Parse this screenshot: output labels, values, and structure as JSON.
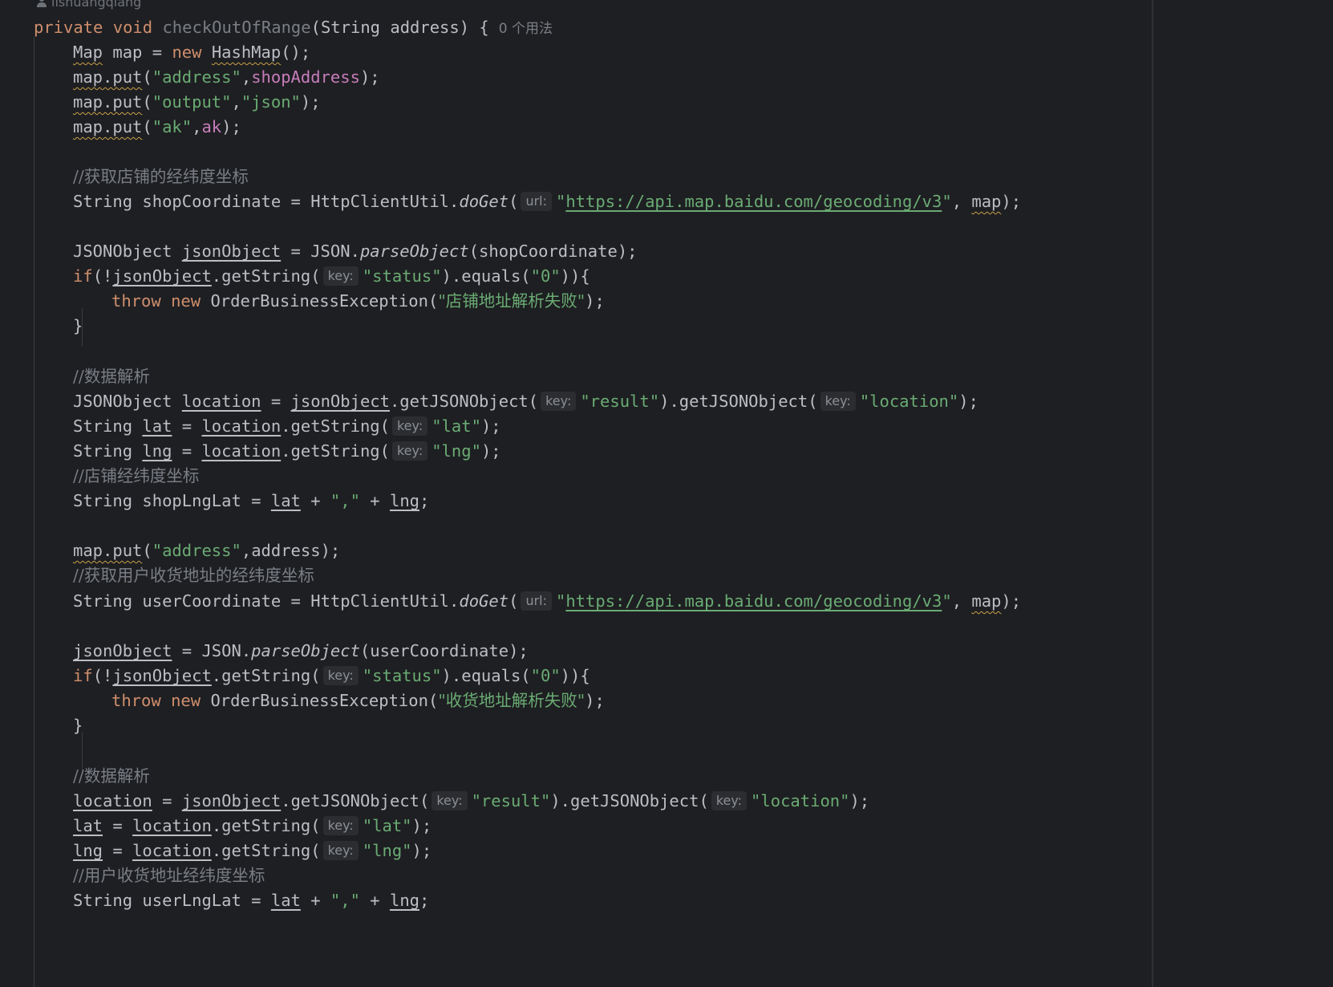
{
  "editor": {
    "author": "lishuangqiang",
    "method": {
      "modifiers": "private",
      "return_type": "void",
      "name": "checkOutOfRange",
      "params": "(String address) {",
      "usages": "0 个用法"
    },
    "code": {
      "map_type": "Map",
      "map_var": "map",
      "eq": " = ",
      "new_kw": "new",
      "hashmap": "HashMap",
      "paren_end": "();",
      "put_call": "map.put",
      "str_address": "\"address\"",
      "shop_address": "shopAddress",
      "str_output": "\"output\"",
      "str_json": "\"json\"",
      "str_ak": "\"ak\"",
      "ak_field": "ak",
      "comment_shop_coord": "//获取店铺的经纬度坐标",
      "string_type": "String",
      "shop_coordinate": "shopCoordinate",
      "http_util": "HttpClientUtil.",
      "do_get": "doGet",
      "hint_url": "url:",
      "url_value": "https://api.map.baidu.com/geocoding/v3",
      "quote": "\"",
      "map_arg": "map",
      "json_object_type": "JSONObject",
      "json_object_var": "jsonObject",
      "json_cls": "JSON.",
      "parse_object": "parseObject",
      "if_kw": "if",
      "get_string": ".getString(",
      "hint_key": "key:",
      "str_status": "\"status\"",
      "equals_zero": ").equals(",
      "str_zero": "\"0\"",
      "if_close": ")){",
      "throw_kw": "throw",
      "order_exception": "OrderBusinessException(",
      "err_shop": "\"店铺地址解析失败\"",
      "close_brace": "}",
      "comment_parse": "//数据解析",
      "location_var": "location",
      "get_json_object": ".getJSONObject(",
      "str_result": "\"result\"",
      "str_location": "\"location\"",
      "lat_var": "lat",
      "lng_var": "lng",
      "str_lat": "\"lat\"",
      "str_lng": "\"lng\"",
      "comment_shop_lnglat": "//店铺经纬度坐标",
      "shop_lnglat": "shopLngLat",
      "str_comma": "\",\"",
      "address_var": "address",
      "comment_user_coord": "//获取用户收货地址的经纬度坐标",
      "user_coordinate": "userCoordinate",
      "err_user": "\"收货地址解析失败\"",
      "comment_user_lnglat": "//用户收货地址经纬度坐标",
      "user_lnglat": "userLngLat"
    }
  },
  "colors": {
    "background": "#1e1f22",
    "keyword": "#cf8e6d",
    "string": "#6aab73",
    "field": "#c77dbb",
    "comment": "#7a7e85",
    "text": "#bcbec4",
    "inlay_hint_bg": "#2b2d30"
  }
}
